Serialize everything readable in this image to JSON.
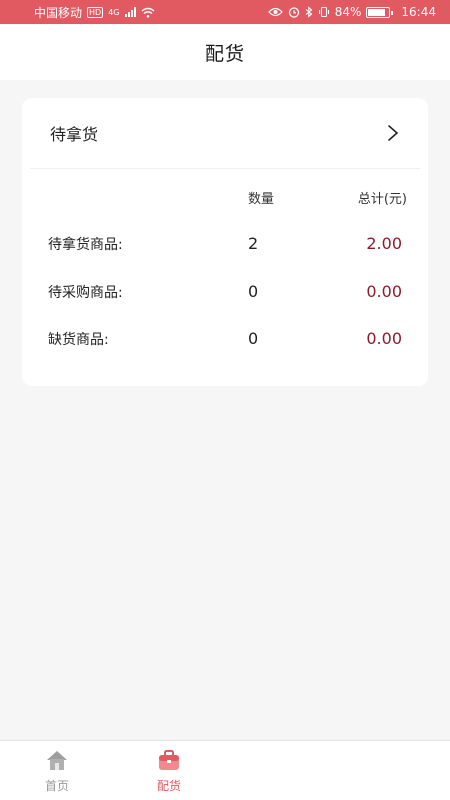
{
  "status_bar": {
    "carrier": "中国移动",
    "hd_badge": "HD",
    "network": "4G",
    "battery": "84%",
    "battery_level": 0.84,
    "time": "16:44",
    "icons": [
      "signal-icon",
      "wifi-icon",
      "eye-icon",
      "alarm-icon",
      "bluetooth-icon",
      "vibrate-icon",
      "battery-icon"
    ]
  },
  "header": {
    "title": "配货"
  },
  "card": {
    "title": "待拿货",
    "columns": {
      "qty": "数量",
      "total": "总计(元)"
    },
    "rows": [
      {
        "label": "待拿货商品:",
        "qty": "2",
        "total": "2.00"
      },
      {
        "label": "待采购商品:",
        "qty": "0",
        "total": "0.00"
      },
      {
        "label": "缺货商品:",
        "qty": "0",
        "total": "0.00"
      }
    ]
  },
  "tabbar": {
    "tabs": [
      {
        "label": "首页",
        "icon": "home-icon",
        "active": false
      },
      {
        "label": "配货",
        "icon": "briefcase-icon",
        "active": true
      }
    ]
  },
  "colors": {
    "accent": "#e15a62",
    "amount": "#8b1d2a",
    "inactive_tab": "#9a9a9a",
    "background": "#f6f6f6"
  }
}
